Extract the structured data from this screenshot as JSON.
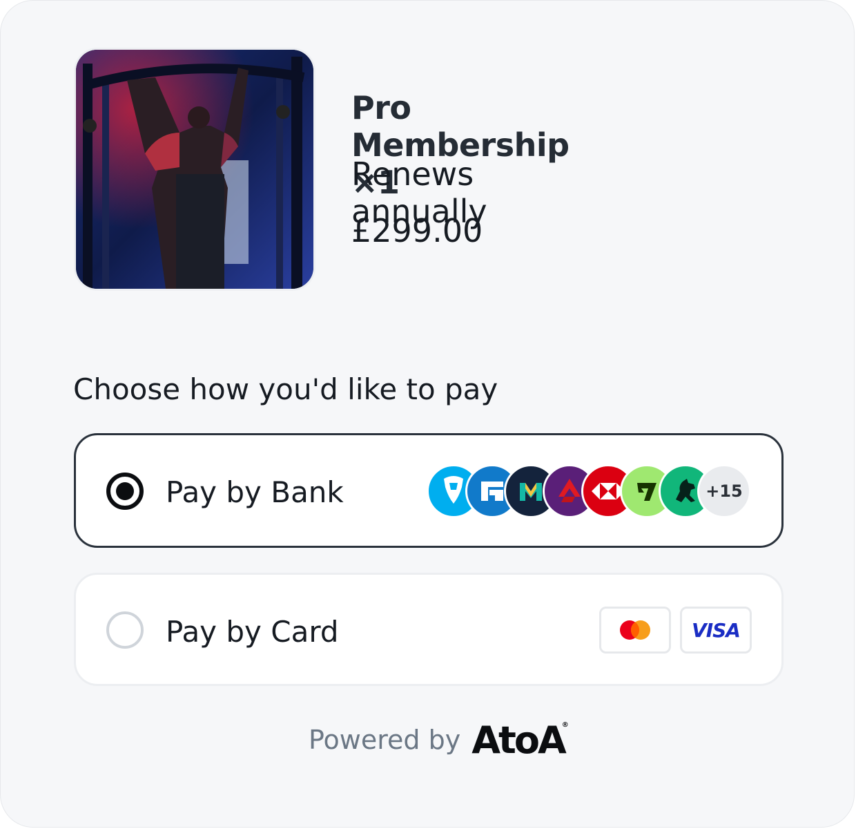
{
  "product": {
    "image_alt": "athlete doing pull-ups in gym",
    "title": "Pro Membership ×1",
    "renewal": "Renews annually",
    "price": "£299.00"
  },
  "payment": {
    "heading": "Choose how you'd like to pay",
    "options": [
      {
        "label": "Pay by Bank",
        "selected": true,
        "bank_icons": [
          "barclays-icon",
          "chase-icon",
          "monzo-icon",
          "natwest-icon",
          "hsbc-icon",
          "wise-icon",
          "lloyds-icon"
        ],
        "more_count": "+15"
      },
      {
        "label": "Pay by Card",
        "selected": false,
        "card_icons": [
          "mastercard-icon",
          "visa-icon"
        ],
        "visa_text": "VISA"
      }
    ]
  },
  "footer": {
    "powered_by": "Powered by",
    "brand": "AtoA",
    "brand_mark": "®"
  },
  "colors": {
    "background": "#f6f7f9",
    "selected_border": "#2a323c",
    "unselected_border": "#eceef1",
    "text": "#161b22",
    "muted_text": "#6b7785"
  }
}
